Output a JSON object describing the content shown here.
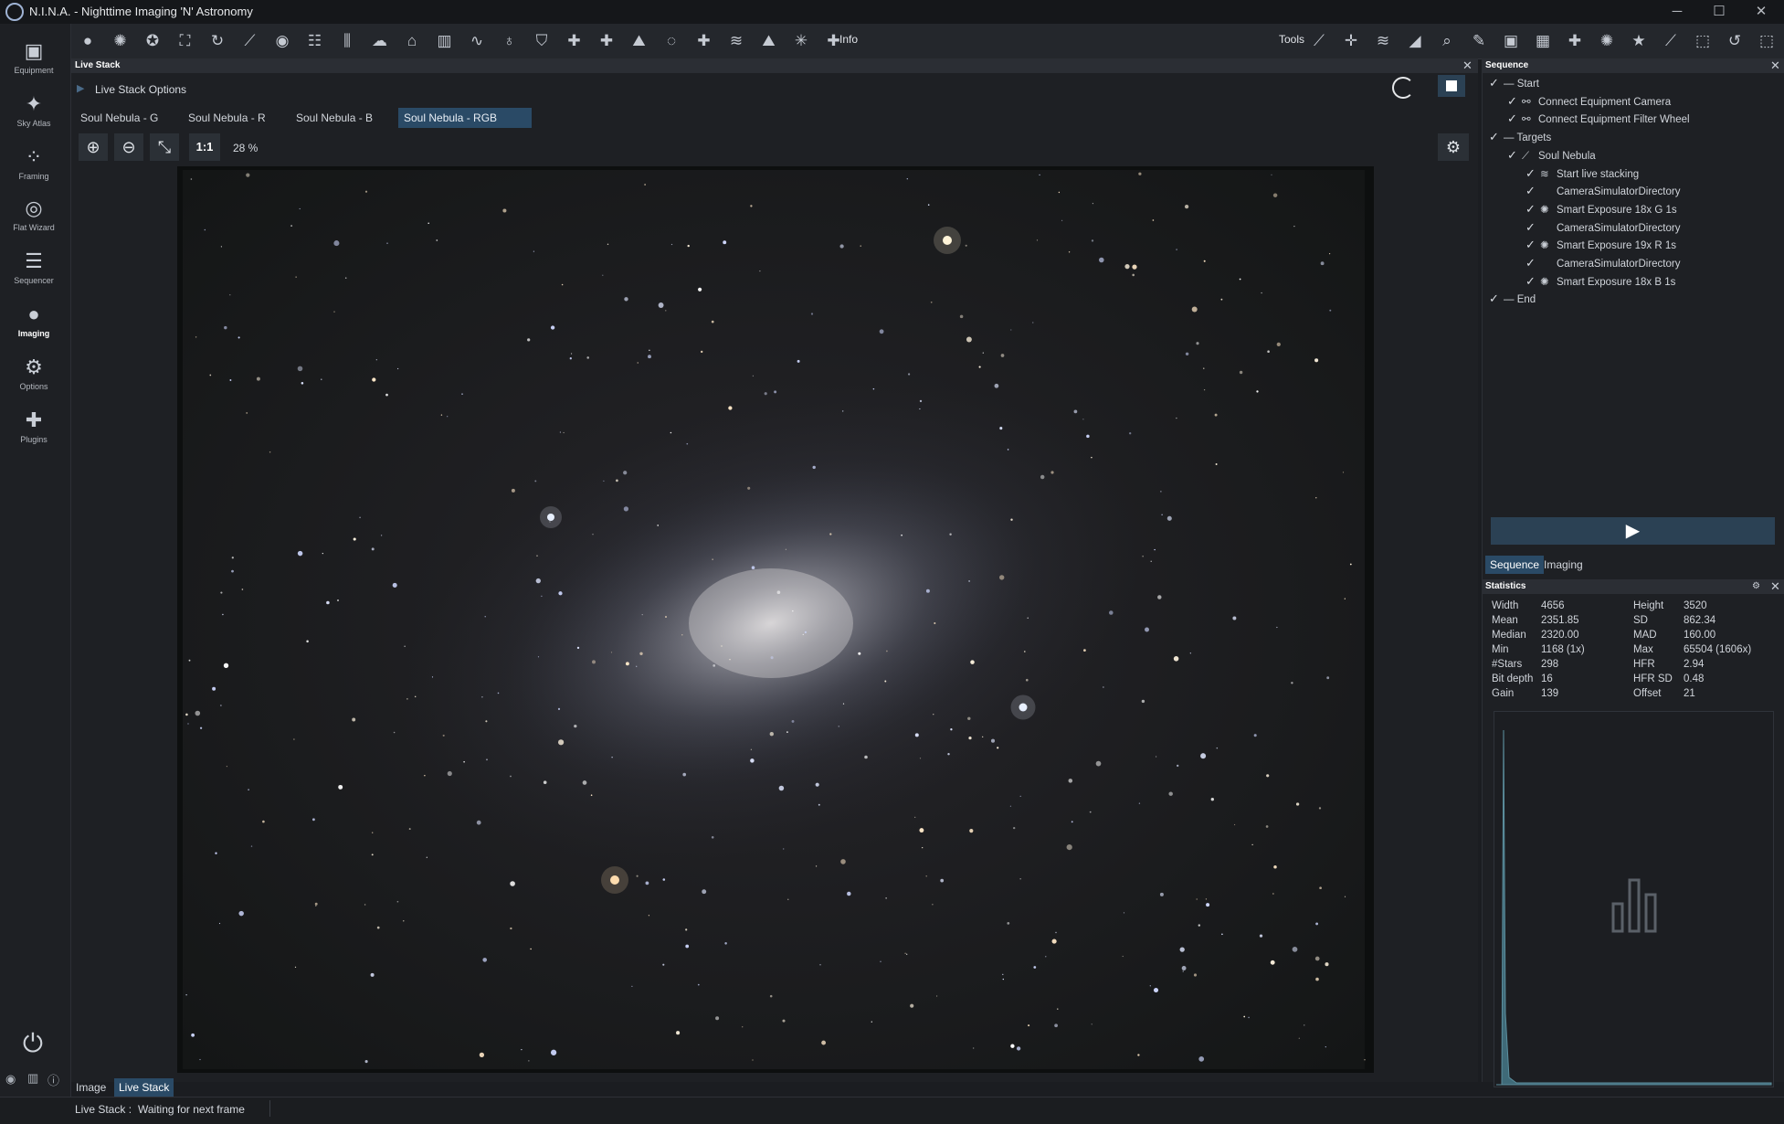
{
  "window": {
    "title": "N.I.N.A. - Nighttime Imaging 'N' Astronomy",
    "minimize": "─",
    "maximize": "☐",
    "close": "✕"
  },
  "nav": [
    {
      "key": "equipment",
      "label": "Equipment",
      "icon": "camera-icon",
      "glyph": "▣"
    },
    {
      "key": "sky-atlas",
      "label": "Sky Atlas",
      "icon": "sky-atlas-icon",
      "glyph": "✦"
    },
    {
      "key": "framing",
      "label": "Framing",
      "icon": "framing-icon",
      "glyph": "⁘"
    },
    {
      "key": "flat-wizard",
      "label": "Flat Wizard",
      "icon": "flat-wizard-icon",
      "glyph": "◎"
    },
    {
      "key": "sequencer",
      "label": "Sequencer",
      "icon": "sequencer-icon",
      "glyph": "☰"
    },
    {
      "key": "imaging",
      "label": "Imaging",
      "icon": "imaging-icon",
      "glyph": "●"
    },
    {
      "key": "options",
      "label": "Options",
      "icon": "gear-icon",
      "glyph": "⚙"
    },
    {
      "key": "plugins",
      "label": "Plugins",
      "icon": "puzzle-icon",
      "glyph": "✚"
    }
  ],
  "nav_bottom": {
    "power": "⏻",
    "collapse": "< <"
  },
  "toolbar": {
    "left_icons": [
      "imaging-dot-icon",
      "aperture-icon",
      "filter-wheel-icon",
      "focus-frame-icon",
      "rotate-icon",
      "telescope-icon",
      "target-icon",
      "list-icon",
      "sliders-icon",
      "cloud-icon",
      "dome-icon",
      "histogram-icon",
      "graph-icon",
      "bulb-icon",
      "shield-icon",
      "puzzle-icon",
      "puzzle-icon",
      "image-icon",
      "guide-icon",
      "puzzle-icon",
      "layers-icon",
      "image-icon",
      "polar-icon",
      "puzzle-icon"
    ],
    "info_label": "Info",
    "tools_label": "Tools",
    "right_icons": [
      "telescope-icon",
      "crosshair-icon",
      "layers-icon",
      "ruler-icon",
      "search-icon",
      "brush-icon",
      "capture-icon",
      "calculator-icon",
      "puzzle-icon",
      "aperture-icon",
      "star-icon",
      "af-icon",
      "frame-icon",
      "history-icon",
      "frame-icon"
    ]
  },
  "livestack": {
    "panel_title": "Live Stack",
    "options_label": "Live Stack Options",
    "tabs": [
      "Soul Nebula - G",
      "Soul Nebula - R",
      "Soul Nebula - B",
      "Soul Nebula - RGB"
    ],
    "active_tab": 3,
    "zoom_one_to_one": "1:1",
    "zoom_percent": "28 %"
  },
  "sequence": {
    "panel_title": "Sequence",
    "rows": [
      {
        "indent": 0,
        "check": true,
        "icon": "",
        "label": "— Start",
        "color": "#d0d4da"
      },
      {
        "indent": 1,
        "check": true,
        "icon": "link-icon",
        "label": "Connect Equipment Camera",
        "color": "#d0d4da"
      },
      {
        "indent": 1,
        "check": true,
        "icon": "link-icon",
        "label": "Connect Equipment Filter Wheel",
        "color": "#d0d4da"
      },
      {
        "indent": 0,
        "check": true,
        "icon": "",
        "label": "— Targets",
        "color": "#d0d4da"
      },
      {
        "indent": 1,
        "check": true,
        "icon": "telescope-icon",
        "label": "Soul Nebula",
        "color": "#d0d4da"
      },
      {
        "indent": 2,
        "check": true,
        "icon": "layers-icon",
        "label": "Start live stacking",
        "color": "#d0d4da"
      },
      {
        "indent": 2,
        "check": true,
        "icon": "",
        "label": "CameraSimulatorDirectory",
        "color": "#d0d4da"
      },
      {
        "indent": 2,
        "check": true,
        "icon": "aperture-icon",
        "label": "Smart Exposure  18x G  1s",
        "color": "#d0d4da"
      },
      {
        "indent": 2,
        "check": true,
        "icon": "",
        "label": "CameraSimulatorDirectory",
        "color": "#d0d4da"
      },
      {
        "indent": 2,
        "check": true,
        "icon": "aperture-icon",
        "label": "Smart Exposure  19x R  1s",
        "color": "#d0d4da"
      },
      {
        "indent": 2,
        "check": true,
        "icon": "",
        "label": "CameraSimulatorDirectory",
        "color": "#d0d4da"
      },
      {
        "indent": 2,
        "check": true,
        "icon": "aperture-icon",
        "label": "Smart Exposure  18x B  1s",
        "color": "#d0d4da"
      },
      {
        "indent": 0,
        "check": true,
        "icon": "",
        "label": "— End",
        "color": "#d0d4da"
      }
    ],
    "tabs": [
      "Sequence",
      "Imaging"
    ],
    "active_tab": 0
  },
  "statistics": {
    "panel_title": "Statistics",
    "left": [
      {
        "label": "Width",
        "value": "4656"
      },
      {
        "label": "Mean",
        "value": "2351.85"
      },
      {
        "label": "Median",
        "value": "2320.00"
      },
      {
        "label": "Min",
        "value": "1168 (1x)"
      },
      {
        "label": "#Stars",
        "value": "298"
      },
      {
        "label": "Bit depth",
        "value": "16"
      },
      {
        "label": "Gain",
        "value": "139"
      }
    ],
    "right": [
      {
        "label": "Height",
        "value": "3520"
      },
      {
        "label": "SD",
        "value": "862.34"
      },
      {
        "label": "MAD",
        "value": "160.00"
      },
      {
        "label": "Max",
        "value": "65504 (1606x)"
      },
      {
        "label": "HFR",
        "value": "2.94"
      },
      {
        "label": "HFR SD",
        "value": "0.48"
      },
      {
        "label": "Offset",
        "value": "21"
      }
    ]
  },
  "bottom_tabs": [
    "Image",
    "Live Stack"
  ],
  "bottom_active": 1,
  "status": {
    "source": "Live Stack :",
    "message": "Waiting for next frame"
  },
  "colors": {
    "accent": "#2a4a66",
    "play_bar": "#2b4154"
  }
}
